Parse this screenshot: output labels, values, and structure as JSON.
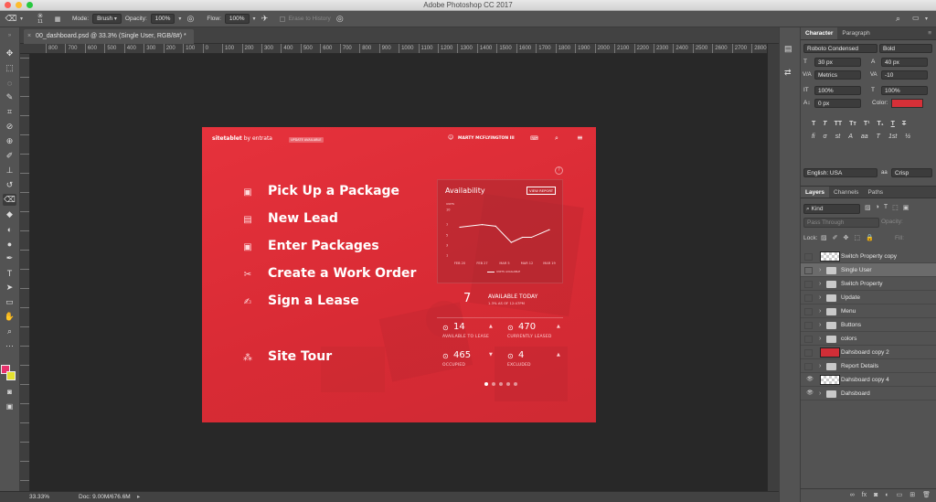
{
  "app": {
    "title": "Adobe Photoshop CC 2017"
  },
  "options_bar": {
    "brush_size": "11",
    "mode_label": "Mode:",
    "mode_value": "Brush",
    "opacity_label": "Opacity:",
    "opacity_value": "100%",
    "flow_label": "Flow:",
    "flow_value": "100%",
    "erase_history_label": "Erase to History"
  },
  "document": {
    "tab_label": "00_dashboard.psd @ 33.3% (Single User, RGB/8#) *",
    "zoom": "33.33%",
    "doc_size": "Doc: 9.00M/676.6M"
  },
  "ruler": {
    "h_ticks": [
      "800",
      "700",
      "600",
      "500",
      "400",
      "300",
      "200",
      "100",
      "0",
      "100",
      "200",
      "300",
      "400",
      "500",
      "600",
      "700",
      "800",
      "900",
      "1000",
      "1100",
      "1200",
      "1300",
      "1400",
      "1500",
      "1600",
      "1700",
      "1800",
      "1900",
      "2000",
      "2100",
      "2200",
      "2300",
      "2400",
      "2500",
      "2600",
      "2700",
      "2800",
      "2900"
    ]
  },
  "character_panel": {
    "tabs": [
      "Character",
      "Paragraph"
    ],
    "font_family": "Roboto Condensed",
    "font_style": "Bold",
    "font_size": "30 px",
    "leading": "40 px",
    "kerning": "Metrics",
    "tracking": "-10",
    "vscale": "100%",
    "hscale": "100%",
    "baseline": "0 px",
    "color_label": "Color:",
    "color_value": "#d63038",
    "language": "English: USA",
    "aa_prefix": "aa",
    "antialias": "Crisp",
    "typo_buttons": [
      "T",
      "T",
      "TT",
      "Tт",
      "T¹",
      "T₁",
      "T",
      "T"
    ]
  },
  "layers_panel": {
    "tabs": [
      "Layers",
      "Channels",
      "Paths"
    ],
    "kind_label": "Kind",
    "blend_mode": "Pass Through",
    "opacity_label": "Opacity:",
    "lock_label": "Lock:",
    "fill_label": "Fill:",
    "layers": [
      {
        "name": "Switch Property copy",
        "type": "pixel",
        "visible": false,
        "selected": false
      },
      {
        "name": "Single User",
        "type": "group",
        "visible": false,
        "selected": true
      },
      {
        "name": "Switch Property",
        "type": "group",
        "visible": false,
        "selected": false
      },
      {
        "name": "Update",
        "type": "group",
        "visible": false,
        "selected": false
      },
      {
        "name": "Menu",
        "type": "group",
        "visible": false,
        "selected": false
      },
      {
        "name": "Buttons",
        "type": "group",
        "visible": false,
        "selected": false
      },
      {
        "name": "colors",
        "type": "group",
        "visible": false,
        "selected": false
      },
      {
        "name": "Dahsboard copy 2",
        "type": "red",
        "visible": false,
        "selected": false
      },
      {
        "name": "Report Details",
        "type": "group",
        "visible": false,
        "selected": false
      },
      {
        "name": "Dahsboard copy 4",
        "type": "pixel",
        "visible": true,
        "selected": false
      },
      {
        "name": "Dahsboard",
        "type": "group",
        "visible": true,
        "selected": false
      }
    ]
  },
  "artwork": {
    "brand": "sitetablet",
    "brand_by": " by entrata",
    "badge": "UPDATE AVAILABLE",
    "user_name": "MARTY MCFLYINGTON III",
    "menu": [
      {
        "label": "Pick Up a Package",
        "icon": "package-icon"
      },
      {
        "label": "New Lead",
        "icon": "lead-card-icon"
      },
      {
        "label": "Enter Packages",
        "icon": "packages-icon"
      },
      {
        "label": "Create a Work Order",
        "icon": "tools-icon"
      },
      {
        "label": "Sign a Lease",
        "icon": "signature-icon"
      }
    ],
    "site_tour": "Site Tour",
    "help_mark": "?",
    "availability": {
      "title": "Availability",
      "view_report": "VIEW REPORT",
      "units_label": "UNITS",
      "legend": "UNITS AVAILABLE",
      "today_value": "7",
      "today_label": "AVAILABLE TODAY",
      "today_sub": "1.3% AS OF 12:47PM",
      "stats": [
        {
          "value": "14",
          "label": "AVAILABLE TO LEASE"
        },
        {
          "value": "470",
          "label": "CURRENTLY LEASED"
        },
        {
          "value": "465",
          "label": "OCCUPIED"
        },
        {
          "value": "4",
          "label": "EXCLUDED"
        }
      ]
    },
    "chart_data": {
      "type": "line",
      "categories": [
        "FEB 20",
        "FEB 27",
        "MAR 5",
        "MAR 12",
        "MAR 19"
      ],
      "y_ticks": [
        "10",
        "7",
        "5",
        "3",
        "1"
      ],
      "ylim": [
        1,
        10
      ],
      "ylabel": "UNITS",
      "series": [
        {
          "name": "UNITS AVAILABLE",
          "values": [
            6.5,
            7,
            6.7,
            3.5,
            4.5,
            4.5,
            6
          ]
        }
      ],
      "x_points": [
        0,
        1,
        1.6,
        2.3,
        2.8,
        3.2,
        4
      ]
    }
  }
}
